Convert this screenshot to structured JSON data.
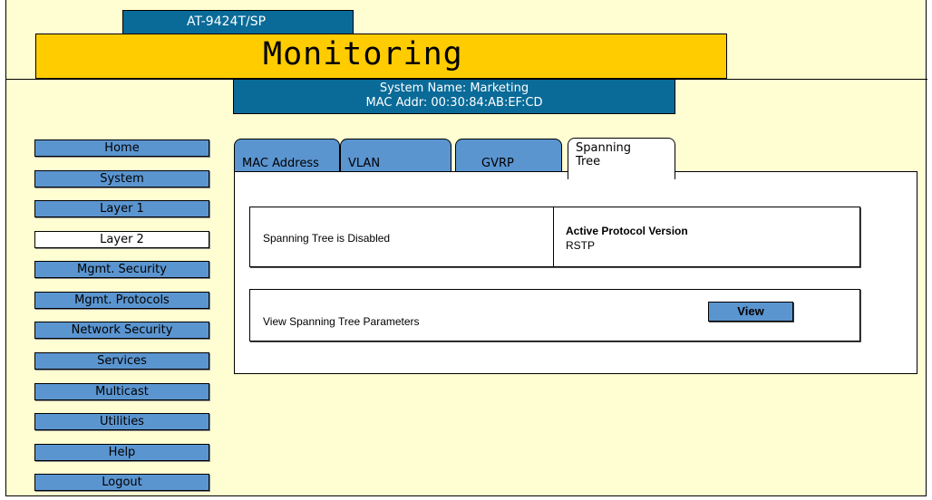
{
  "header": {
    "model": "AT-9424T/SP",
    "title": "Monitoring",
    "system_name": "System Name: Marketing",
    "mac_addr": "MAC Addr: 00:30:84:AB:EF:CD"
  },
  "nav": {
    "items": [
      {
        "label": "Home"
      },
      {
        "label": "System"
      },
      {
        "label": "Layer 1"
      },
      {
        "label": "Layer 2",
        "active": true
      },
      {
        "label": "Mgmt. Security"
      },
      {
        "label": "Mgmt. Protocols"
      },
      {
        "label": "Network Security"
      },
      {
        "label": "Services"
      },
      {
        "label": "Multicast"
      },
      {
        "label": "Utilities"
      },
      {
        "label": "Help"
      },
      {
        "label": "Logout"
      }
    ]
  },
  "tabs": [
    {
      "label": "MAC Address"
    },
    {
      "label": "VLAN"
    },
    {
      "label": "GVRP"
    },
    {
      "label_line1": "Spanning",
      "label_line2": "Tree",
      "active": true
    }
  ],
  "status_panel": {
    "status": "Spanning Tree is Disabled",
    "protocol_heading": "Active Protocol Version",
    "protocol_value": "RSTP"
  },
  "params_panel": {
    "label": "View Spanning Tree Parameters",
    "button": "View"
  },
  "colors": {
    "background": "#fffdd2",
    "header_blue": "#0a6b98",
    "title_yellow": "#ffcc00",
    "button_blue": "#5b95d0"
  }
}
